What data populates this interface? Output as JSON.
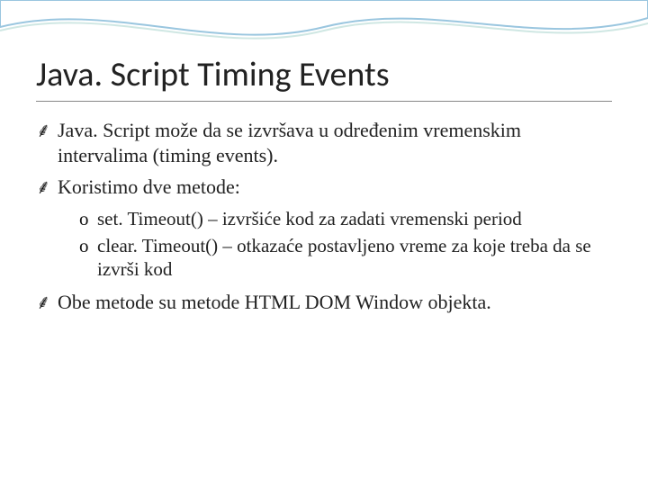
{
  "slide": {
    "title": "Java. Script Timing Events",
    "bullets": [
      {
        "level": 1,
        "marker": "curl",
        "text": "Java. Script može da se izvršava u određenim vremenskim intervalima (timing events)."
      },
      {
        "level": 1,
        "marker": "curl",
        "text": "Koristimo dve metode:"
      },
      {
        "level": 2,
        "marker": "o",
        "text": "set. Timeout() – izvršiće kod za zadati vremenski period"
      },
      {
        "level": 2,
        "marker": "o",
        "text": "clear. Timeout() – otkazaće postavljeno vreme za koje treba da se izvrši kod"
      },
      {
        "level": 1,
        "marker": "curl",
        "text": "Obe metode su metode HTML DOM Window objekta."
      }
    ],
    "markers": {
      "curl": "⸙",
      "o": "o"
    }
  }
}
